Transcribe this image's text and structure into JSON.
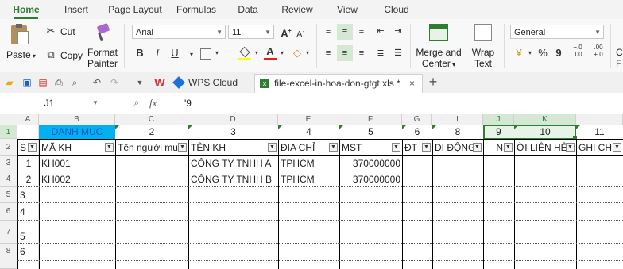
{
  "menu": [
    "Home",
    "Insert",
    "Page Layout",
    "Formulas",
    "Data",
    "Review",
    "View",
    "Cloud"
  ],
  "ribbon": {
    "paste": "Paste",
    "cut": "Cut",
    "copy": "Copy",
    "format_painter_1": "Format",
    "format_painter_2": "Painter",
    "font_name": "Arial",
    "font_size": "11",
    "merge_1": "Merge and",
    "merge_2": "Center",
    "wrap_1": "Wrap",
    "wrap_2": "Text",
    "number_format": "General",
    "percent": "%",
    "comma": "9",
    "dec_inc": "+.0 .00",
    "dec_dec": ".00 +.0",
    "extra": "C",
    "extra2": "F"
  },
  "quickbar": {
    "wps_label": "W",
    "wps_cloud": "WPS Cloud",
    "file_tab": "file-excel-in-hoa-don-gtgt.xls *",
    "close": "×",
    "add": "+"
  },
  "formula_bar": {
    "name_box": "J1",
    "fx": "fx",
    "value": "'9"
  },
  "columns": [
    "A",
    "B",
    "C",
    "D",
    "E",
    "F",
    "G",
    "I",
    "J",
    "K",
    "L"
  ],
  "rows": [
    "1",
    "2",
    "3",
    "4",
    "5",
    "6",
    "7",
    "8"
  ],
  "row1": [
    "DANH MUC",
    "2",
    "3",
    "4",
    "5",
    "6",
    "8",
    "9",
    "10",
    "11"
  ],
  "headers": [
    "S",
    "MÃ KH",
    "Tên người mu",
    "TÊN KH",
    "ĐỊA CHỈ",
    "MST",
    "ĐT",
    "DI ĐỘNG",
    "N",
    "ỜI LIÊN HỆ",
    "GHI CH"
  ],
  "data_rows": [
    {
      "stt": "1",
      "makh": "KH001",
      "tenkh": "CÔNG TY TNHH A",
      "diachi": "TPHCM",
      "mst": "370000000"
    },
    {
      "stt": "2",
      "makh": "KH002",
      "tenkh": "CÔNG TY TNHH B",
      "diachi": "TPHCM",
      "mst": "370000000"
    },
    {
      "stt": "3"
    },
    {
      "stt": "4"
    },
    {
      "stt": "5"
    },
    {
      "stt": "6"
    }
  ],
  "colors": {
    "accent": "#2e7d32",
    "link": "#1155cc",
    "cyan": "#00b0f0"
  }
}
